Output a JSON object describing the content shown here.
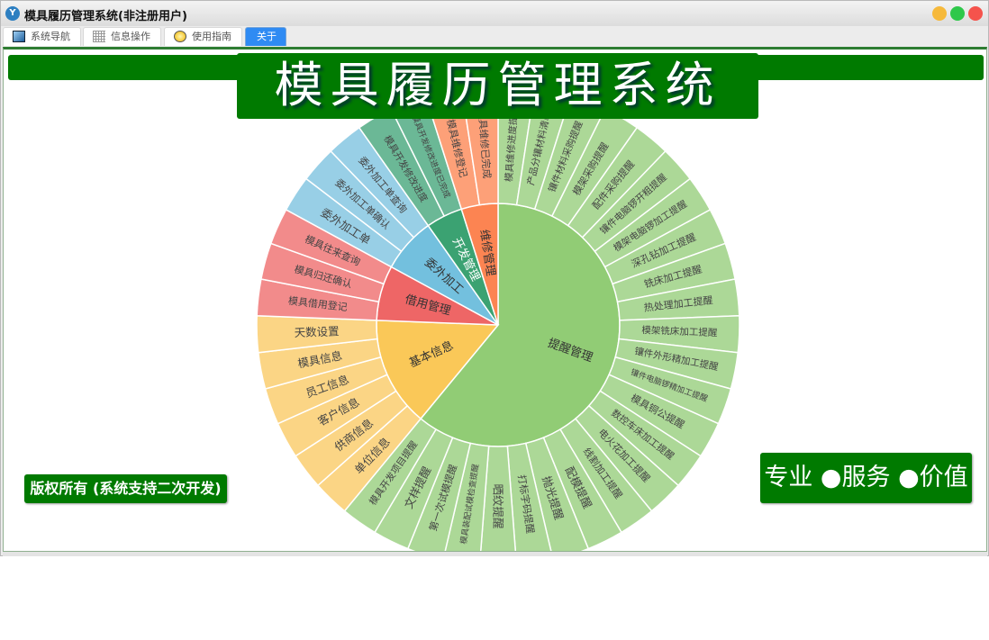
{
  "window": {
    "title": "模具履历管理系统(非注册用户)",
    "app_icon": "cloud-y-icon"
  },
  "window_controls": {
    "colors": [
      "#f6b93b",
      "#2ec84a",
      "#f5534c"
    ]
  },
  "tabs": [
    {
      "label": "系统导航",
      "icon": "monitor-icon"
    },
    {
      "label": "信息操作",
      "icon": "grid-icon"
    },
    {
      "label": "使用指南",
      "icon": "help-bulb-icon"
    },
    {
      "label": "关于",
      "active": true
    }
  ],
  "page": {
    "title": "模具履历管理系统",
    "copyright": "版权所有 (系统支持二次开发)",
    "slogan": "专业 ●服务 ●价值",
    "brand_color": "#007a00"
  },
  "chart_data": {
    "type": "sunburst",
    "categories": [
      {
        "name": "提醒管理",
        "color": "#91cc75",
        "leaf_color": "#acd897",
        "children": [
          "模具维修进度提醒",
          "产品分镶材料清单",
          "镶件材料采购提醒",
          "模架采购提醒",
          "配件采购提醒",
          "镶件电脑锣开粗提醒",
          "模架电脑锣加工提醒",
          "深孔钻加工提醒",
          "铣床加工提醒",
          "热处理加工提醒",
          "模架铣床加工提醒",
          "镶件外形精加工提醒",
          "镶件电脑锣精加工提醒",
          "模具铜公提醒",
          "数控车床加工提醒",
          "电火花加工提醒",
          "线割加工提醒",
          "配模提醒",
          "抛光提醒",
          "打标字码提醒",
          "晒纹提醒",
          "模具装配试模检查提醒",
          "第一次试模提醒",
          "文样提醒",
          "模具开发项目提醒"
        ]
      },
      {
        "name": "基本信息",
        "color": "#fac858",
        "leaf_color": "#fbd585",
        "children": [
          "单位信息",
          "供商信息",
          "客户信息",
          "员工信息",
          "模具信息",
          "天数设置"
        ]
      },
      {
        "name": "借用管理",
        "color": "#ee6666",
        "leaf_color": "#f28b8b",
        "children": [
          "模具借用登记",
          "模具归还确认",
          "模具往来查询"
        ]
      },
      {
        "name": "委外加工",
        "color": "#73c0de",
        "leaf_color": "#98cfe6",
        "children": [
          "委外加工单",
          "委外加工单确认",
          "委外加工单查询"
        ]
      },
      {
        "name": "开发管理",
        "color": "#3ba272",
        "leaf_color": "#6bb896",
        "children": [
          "模具开发修改进度",
          "模具开发修改进度已完成"
        ]
      },
      {
        "name": "维修管理",
        "color": "#fc8452",
        "leaf_color": "#fda078",
        "children": [
          "模具维修登记",
          "模具维修已完成"
        ]
      }
    ],
    "leaf_value": 1
  }
}
